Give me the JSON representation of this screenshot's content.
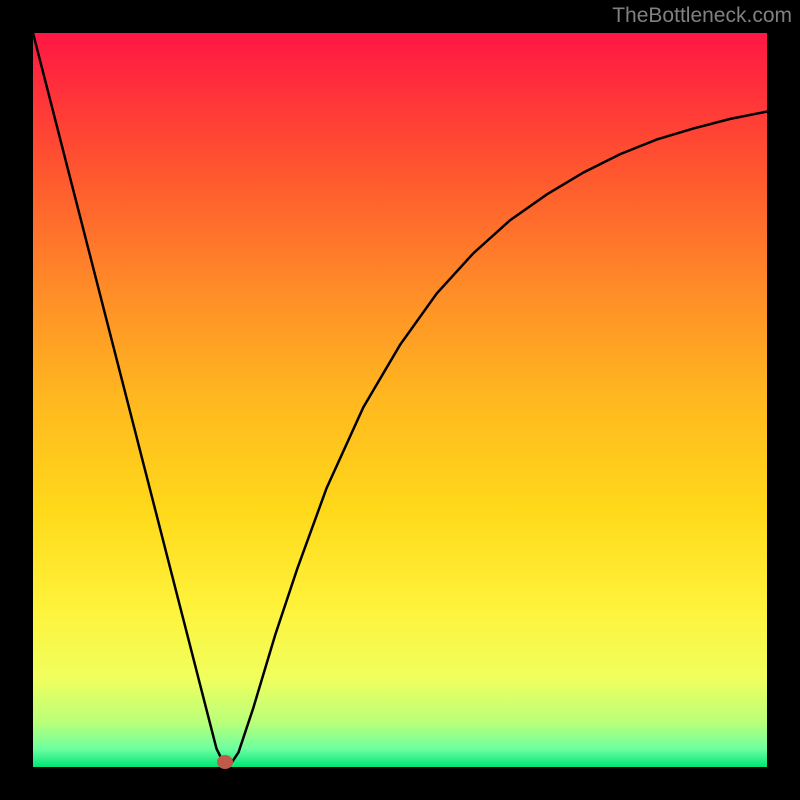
{
  "watermark": "TheBottleneck.com",
  "marker": {
    "x_pct": 26.2,
    "y_pct": 99.3
  },
  "chart_data": {
    "type": "line",
    "title": "",
    "xlabel": "",
    "ylabel": "",
    "xlim": [
      0,
      100
    ],
    "ylim": [
      0,
      100
    ],
    "series": [
      {
        "name": "curve",
        "x": [
          0,
          5,
          10,
          15,
          20,
          23,
          25,
          26,
          27,
          28,
          30,
          33,
          36,
          40,
          45,
          50,
          55,
          60,
          65,
          70,
          75,
          80,
          85,
          90,
          95,
          100
        ],
        "y": [
          100,
          80.5,
          61,
          41.5,
          22,
          10.3,
          2.5,
          0.5,
          0.5,
          2,
          8,
          18,
          27,
          38,
          49,
          57.5,
          64.5,
          70,
          74.5,
          78,
          81,
          83.5,
          85.5,
          87,
          88.3,
          89.3
        ]
      }
    ],
    "marker_point": {
      "x": 26.2,
      "y": 0.7
    },
    "gradient": {
      "stops": [
        {
          "pos": 0.0,
          "color": "#ff1744"
        },
        {
          "pos": 0.1,
          "color": "#ff3838"
        },
        {
          "pos": 0.2,
          "color": "#ff5a2e"
        },
        {
          "pos": 0.35,
          "color": "#ff8c28"
        },
        {
          "pos": 0.5,
          "color": "#ffb81f"
        },
        {
          "pos": 0.65,
          "color": "#ffd91a"
        },
        {
          "pos": 0.78,
          "color": "#fff23a"
        },
        {
          "pos": 0.88,
          "color": "#f0ff5e"
        },
        {
          "pos": 0.94,
          "color": "#b8ff7a"
        },
        {
          "pos": 0.975,
          "color": "#6effa0"
        },
        {
          "pos": 1.0,
          "color": "#00e676"
        }
      ]
    }
  }
}
